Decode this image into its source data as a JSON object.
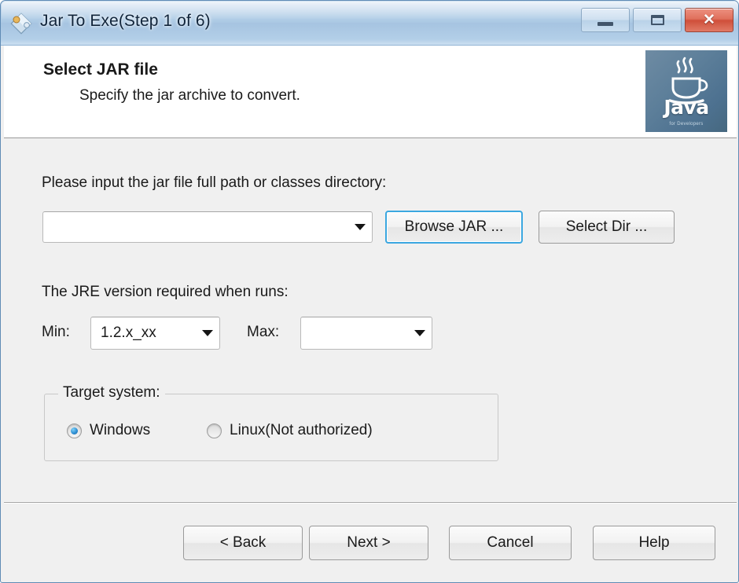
{
  "window": {
    "title": "Jar To Exe(Step 1 of 6)",
    "app_icon": "jar-to-exe-icon",
    "controls": {
      "minimize": "minimize-icon",
      "maximize": "maximize-icon",
      "close": "close-icon",
      "close_glyph": "✕"
    }
  },
  "header": {
    "title": "Select JAR file",
    "subtitle": "Specify the jar archive to convert.",
    "logo": {
      "word": "Java",
      "tagline": "for Developers",
      "icon": "java-coffee-cup-icon"
    }
  },
  "form": {
    "jar_path_label": "Please input the jar file full path or classes directory:",
    "jar_path_value": "",
    "jar_path_placeholder": "",
    "browse_jar_button": "Browse JAR ...",
    "select_dir_button": "Select Dir ...",
    "jre_label": "The JRE version required when runs:",
    "min_label": "Min:",
    "min_value": "1.2.x_xx",
    "max_label": "Max:",
    "max_value": "",
    "target_group_title": "Target system:",
    "radios": [
      {
        "label": "Windows",
        "checked": true
      },
      {
        "label": "Linux(Not authorized)",
        "checked": false
      }
    ]
  },
  "footer": {
    "back_button": "< Back",
    "next_button": "Next >",
    "cancel_button": "Cancel",
    "help_button": "Help"
  },
  "colors": {
    "titlebar_blue": "#aecbe5",
    "body_gray": "#f0f0f0",
    "focus_ring": "#3ba7e0",
    "radio_accent": "#2f8fd4",
    "close_red": "#cf4f3a"
  }
}
